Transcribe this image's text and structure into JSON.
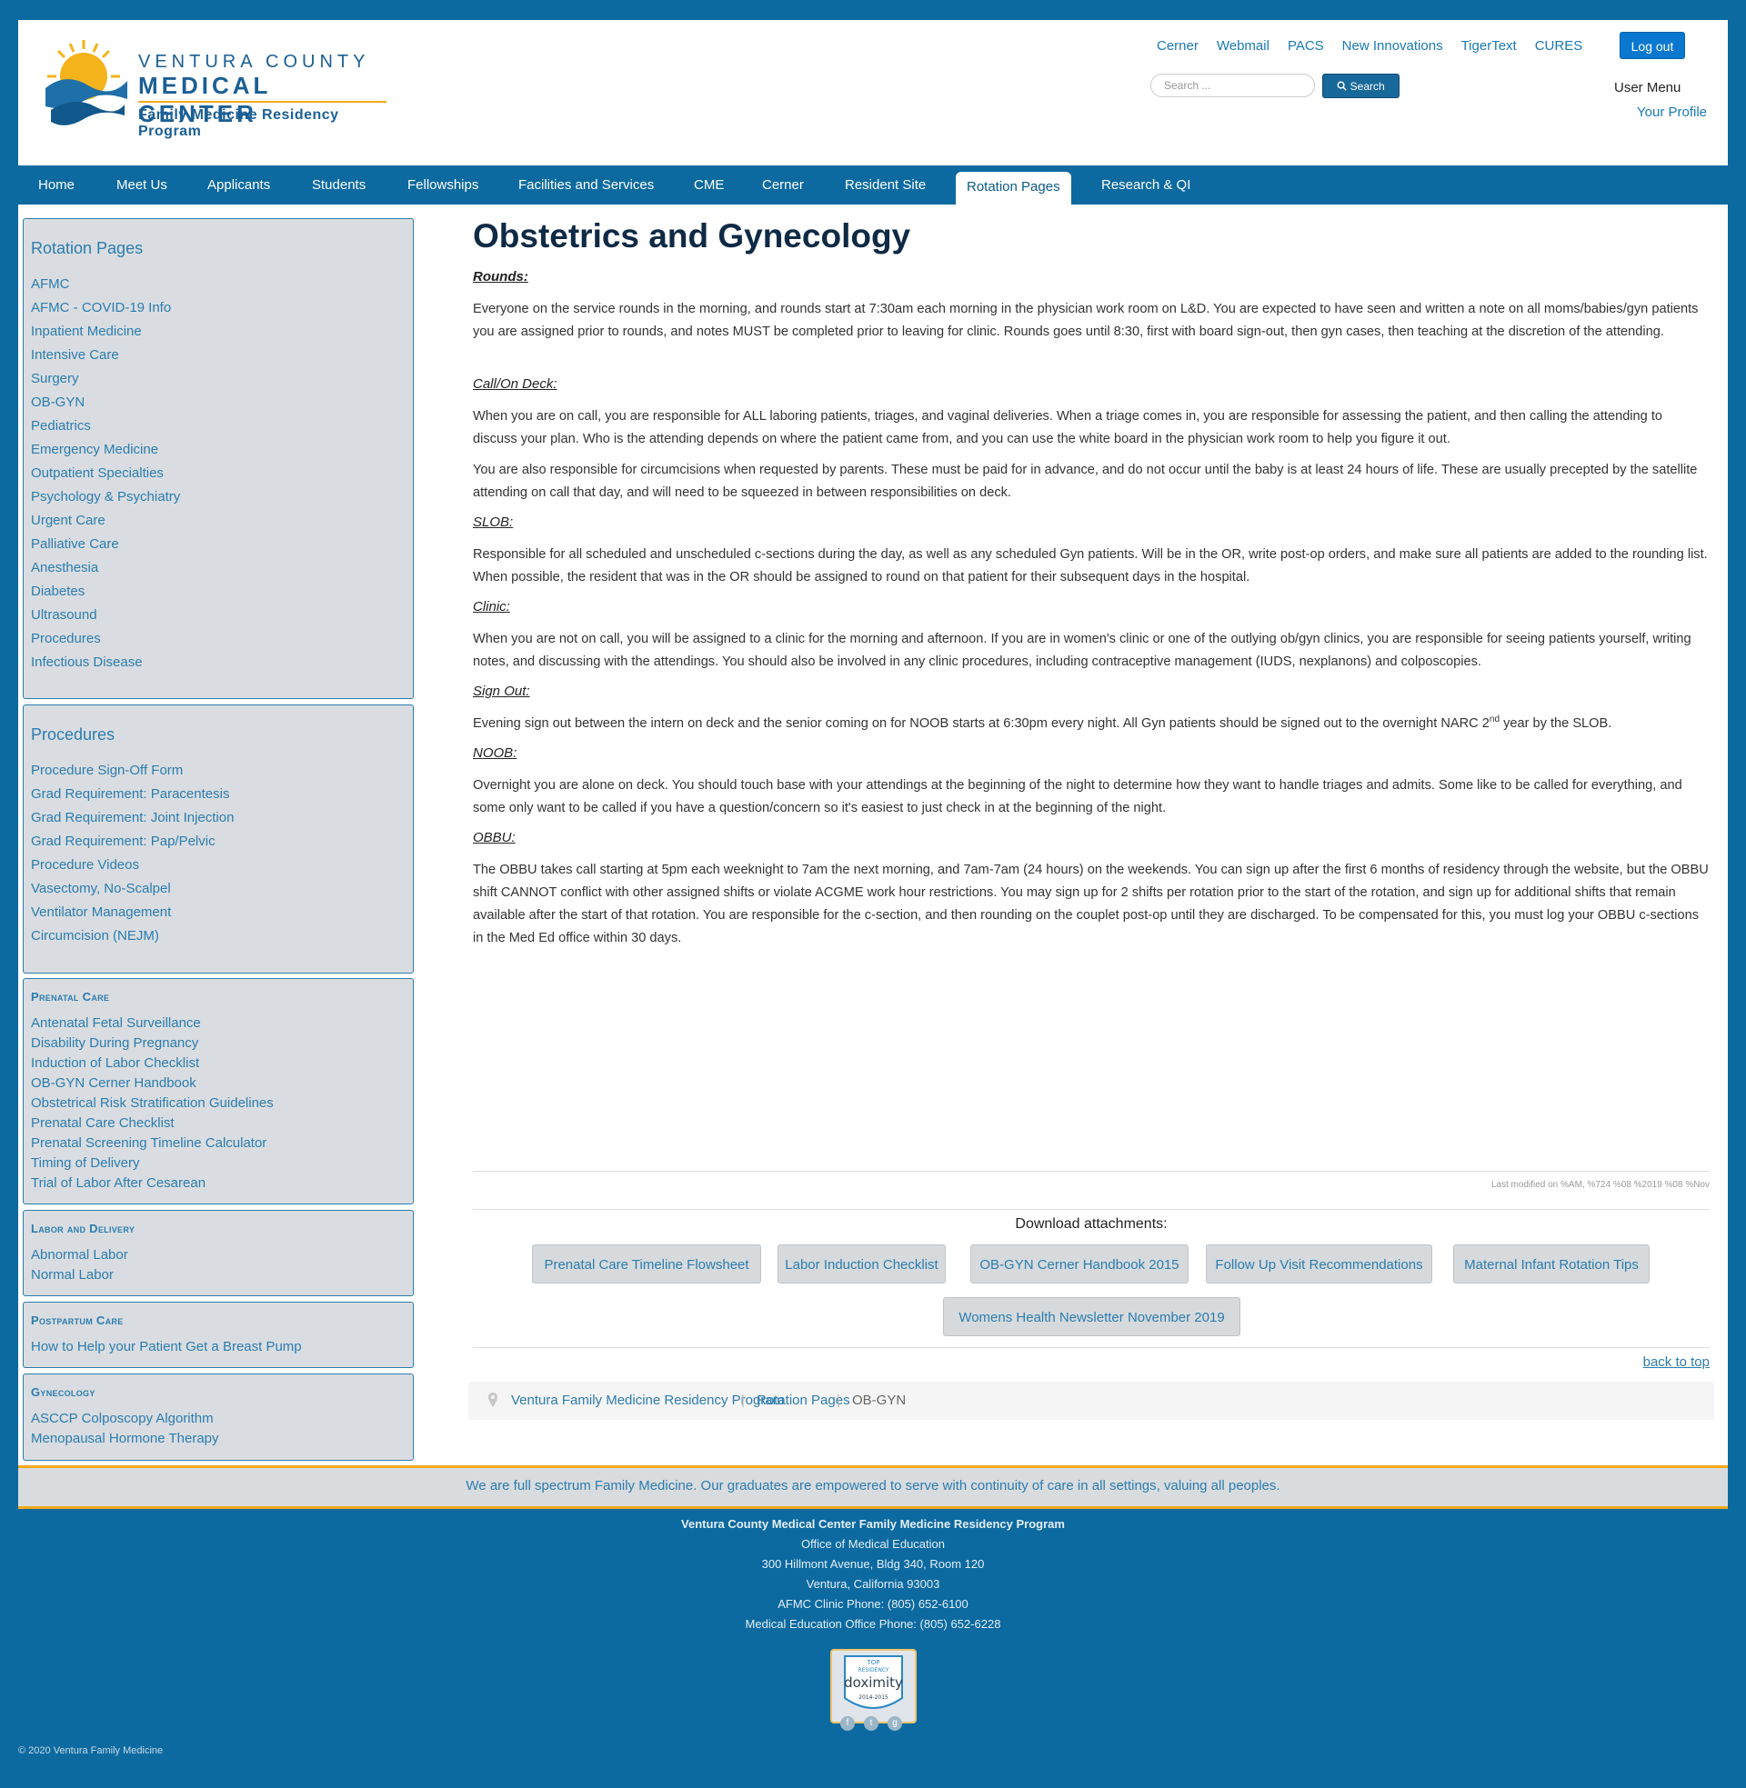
{
  "header": {
    "logo": {
      "line1": "VENTURA COUNTY",
      "line2": "MEDICAL CENTER",
      "line3": "Family Medicine Residency Program"
    },
    "top_links": [
      "Cerner",
      "Webmail",
      "PACS",
      "New Innovations",
      "TigerText",
      "CURES"
    ],
    "logout_label": "Log out",
    "search_placeholder": "Search ...",
    "search_button": "Search",
    "user_menu_title": "User Menu",
    "your_profile": "Your Profile"
  },
  "nav": {
    "items": [
      "Home",
      "Meet Us",
      "Applicants",
      "Students",
      "Fellowships",
      "Facilities and Services",
      "CME",
      "Cerner",
      "Resident Site",
      "Rotation Pages",
      "Research & QI"
    ],
    "active": "Rotation Pages"
  },
  "sidebar": {
    "rotation_pages": {
      "title": "Rotation Pages",
      "links": [
        "AFMC",
        "AFMC - COVID-19 Info",
        "Inpatient Medicine",
        "Intensive Care",
        "Surgery",
        "OB-GYN",
        "Pediatrics",
        "Emergency Medicine",
        "Outpatient Specialties",
        "Psychology & Psychiatry",
        "Urgent Care",
        "Palliative Care",
        "Anesthesia",
        "Diabetes",
        "Ultrasound",
        "Procedures",
        "Infectious Disease"
      ]
    },
    "procedures": {
      "title": "Procedures",
      "links": [
        "Procedure Sign-Off Form",
        "Grad Requirement: Paracentesis",
        "Grad Requirement: Joint Injection",
        "Grad Requirement: Pap/Pelvic",
        "Procedure Videos",
        "Vasectomy, No-Scalpel",
        "Ventilator Management",
        "Circumcision (NEJM)"
      ]
    },
    "prenatal_care": {
      "title": "Prenatal Care",
      "links": [
        "Antenatal Fetal Surveillance",
        "Disability During Pregnancy",
        "Induction of Labor Checklist",
        "OB-GYN Cerner Handbook",
        "Obstetrical Risk Stratification Guidelines",
        "Prenatal Care Checklist",
        "Prenatal Screening Timeline Calculator",
        "Timing of Delivery",
        "Trial of Labor After Cesarean"
      ]
    },
    "labor_delivery": {
      "title": "Labor and Delivery",
      "links": [
        "Abnormal Labor",
        "Normal Labor"
      ]
    },
    "postpartum": {
      "title": "Postpartum Care",
      "links": [
        "How to Help your Patient Get a Breast Pump"
      ]
    },
    "gynecology": {
      "title": "Gynecology",
      "links": [
        "ASCCP Colposcopy Algorithm",
        "Menopausal Hormone Therapy"
      ]
    }
  },
  "main": {
    "title": "Obstetrics and Gynecology",
    "sections": {
      "rounds_h": "Rounds:",
      "rounds_p": "Everyone on the service rounds in the morning, and rounds start at 7:30am each morning in the physician work room on L&D.  You are expected to have seen and written a note on all moms/babies/gyn patients you are assigned prior to rounds, and notes MUST be completed prior to leaving for clinic.  Rounds goes until 8:30, first with board sign-out, then gyn cases, then teaching at the discretion of the attending.",
      "call_h": "Call/On Deck:",
      "call_p1": "When you are on call, you are responsible for ALL laboring patients, triages, and vaginal deliveries.  When a triage comes in, you are responsible for assessing the patient, and then calling the attending to discuss your plan.  Who is the attending depends on where the patient came from, and you can use the white board in the physician work room to help you figure it out.",
      "call_p2": "You are also responsible for circumcisions when requested by parents.  These must be paid for in advance, and do not occur until the baby is at least 24 hours of life.  These are usually precepted by the satellite attending on call that day, and will need to be squeezed in between responsibilities on deck.",
      "slob_h": "SLOB:",
      "slob_p": "Responsible for all scheduled and unscheduled c-sections during the day, as well as any scheduled Gyn patients.  Will be in the OR, write post-op orders, and make sure all patients are added to the rounding list.  When possible, the resident that was in the OR should be assigned to round on that patient for their subsequent days in the hospital.",
      "clinic_h": "Clinic:",
      "clinic_p": "When you are not on call, you will be assigned to a clinic for the morning and afternoon.  If you are in women's clinic or one of the outlying ob/gyn clinics, you are responsible for seeing patients yourself, writing notes, and discussing with the attendings.  You should also be involved in any clinic procedures, including contraceptive management (IUDS, nexplanons) and colposcopies.",
      "signout_h": "Sign Out:",
      "signout_p_a": "Evening sign out between the intern on deck and the senior coming on for NOOB starts at 6:30pm every night.  All Gyn patients should be signed out to the overnight NARC 2",
      "signout_p_sup": "nd",
      "signout_p_b": " year by the SLOB.",
      "noob_h": "NOOB:",
      "noob_p": "Overnight you are alone on deck.  You should touch base with your attendings at the beginning of the night to determine how they want to handle triages and admits.  Some like to be called for everything, and some only want to be called if you have a question/concern so it's easiest to just check in at the beginning of the night.",
      "obbu_h": "OBBU:",
      "obbu_p": "The OBBU takes call starting at 5pm each weeknight to 7am the next morning, and 7am-7am (24 hours) on the weekends.  You can sign up after the first 6 months of residency through the website, but the OBBU shift CANNOT conflict with other assigned shifts or violate ACGME work hour restrictions.  You may sign up for 2 shifts per rotation prior to the start of the rotation, and sign up for additional shifts that remain available after the start of that rotation.  You are responsible for the c-section, and then rounding on the couplet post-op until they are discharged.  To be compensated for this, you must log your OBBU c-sections in the Med Ed office within 30 days."
    },
    "last_modified": "Last modified on %AM, %724 %08 %2019 %08 %Nov",
    "download_label": "Download attachments:",
    "attachments": [
      "Prenatal Care Timeline Flowsheet",
      "Labor Induction Checklist",
      "OB-GYN Cerner Handbook 2015",
      "Follow Up Visit Recommendations",
      "Maternal Infant Rotation Tips",
      "Womens Health Newsletter November 2019"
    ],
    "back_to_top": "back to top",
    "breadcrumb": [
      "Ventura Family Medicine Residency Program",
      "Rotation Pages",
      "OB-GYN"
    ]
  },
  "footer": {
    "tagline": "We are full spectrum Family Medicine. Our graduates are empowered to serve with continuity of care in all settings, valuing all peoples.",
    "org": "Ventura County Medical Center Family Medicine Residency Program",
    "office": "Office of Medical Education",
    "address1": "300 Hillmont Avenue, Bldg 340, Room 120",
    "address2": "Ventura, California 93003",
    "phone1": "AFMC Clinic Phone: (805) 652-6100",
    "phone2": "Medical Education Office Phone: (805) 652-6228",
    "badge": {
      "top": "TOP",
      "residency": "RESIDENCY",
      "brand": "doximity",
      "years": "2014-2015"
    },
    "social_icons": [
      "facebook-icon",
      "twitter-icon",
      "google-plus-icon"
    ],
    "copyright": "© 2020 Ventura Family Medicine"
  },
  "colors": {
    "brand_blue": "#0c6aa0",
    "link": "#2c7cae",
    "accent_gold": "#f2a91a"
  }
}
